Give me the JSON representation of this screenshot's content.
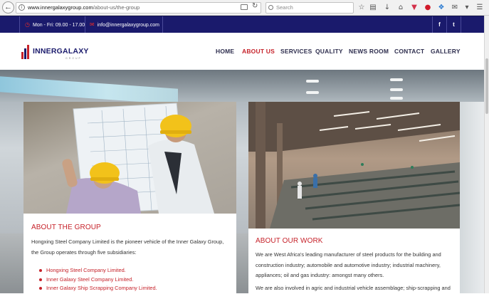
{
  "browser": {
    "url_host": "www.innergalaxygroup.com",
    "url_path": "/about-us/the-group",
    "search_placeholder": "Search",
    "icons": [
      "back-icon",
      "info-icon",
      "reader-view-icon",
      "reload-icon",
      "search-icon",
      "bookmark-star-icon",
      "clipboard-icon",
      "download-icon",
      "home-icon",
      "pocket-icon",
      "pinterest-icon",
      "extension-icon",
      "chat-icon",
      "menu-icon"
    ]
  },
  "topbar": {
    "hours": "Mon - Fri: 09.00 - 17.00",
    "email": "info@innergalaxygroup.com",
    "social": {
      "facebook": "f",
      "twitter": "t"
    }
  },
  "header": {
    "logo_text": "INNERGALAXY",
    "logo_sub": "GROUP",
    "nav": [
      "HOME",
      "ABOUT US",
      "SERVICES",
      "QUALITY",
      "NEWS ROOM",
      "CONTACT",
      "GALLERY"
    ],
    "active_nav": "ABOUT US"
  },
  "about_group": {
    "title": "ABOUT THE GROUP",
    "text": "Hongxing Steel Company Limited is the pioneer vehicle of the Inner Galaxy Group, the Group operates through five subsidiaries:",
    "subsidiaries": [
      "Hongxing Steel Company Limited.",
      "Inner Galaxy Steel Company Limited.",
      "Inner Galaxy Ship Scrapping Company Limited."
    ]
  },
  "about_work": {
    "title": "ABOUT OUR WORK",
    "paragraph1": "We are West Africa's leading manufacturer of steel products for the building and construction industry; automobile and automotive industry; industrial machinery, appliances; oil and gas industry: amongst many others.",
    "paragraph2": "We are also involved in agric and industrial vehicle assemblage; ship-scrapping and"
  },
  "colors": {
    "brand_navy": "#1a1a6c",
    "accent_red": "#c6222a",
    "nav_text": "#2e2e4e"
  }
}
